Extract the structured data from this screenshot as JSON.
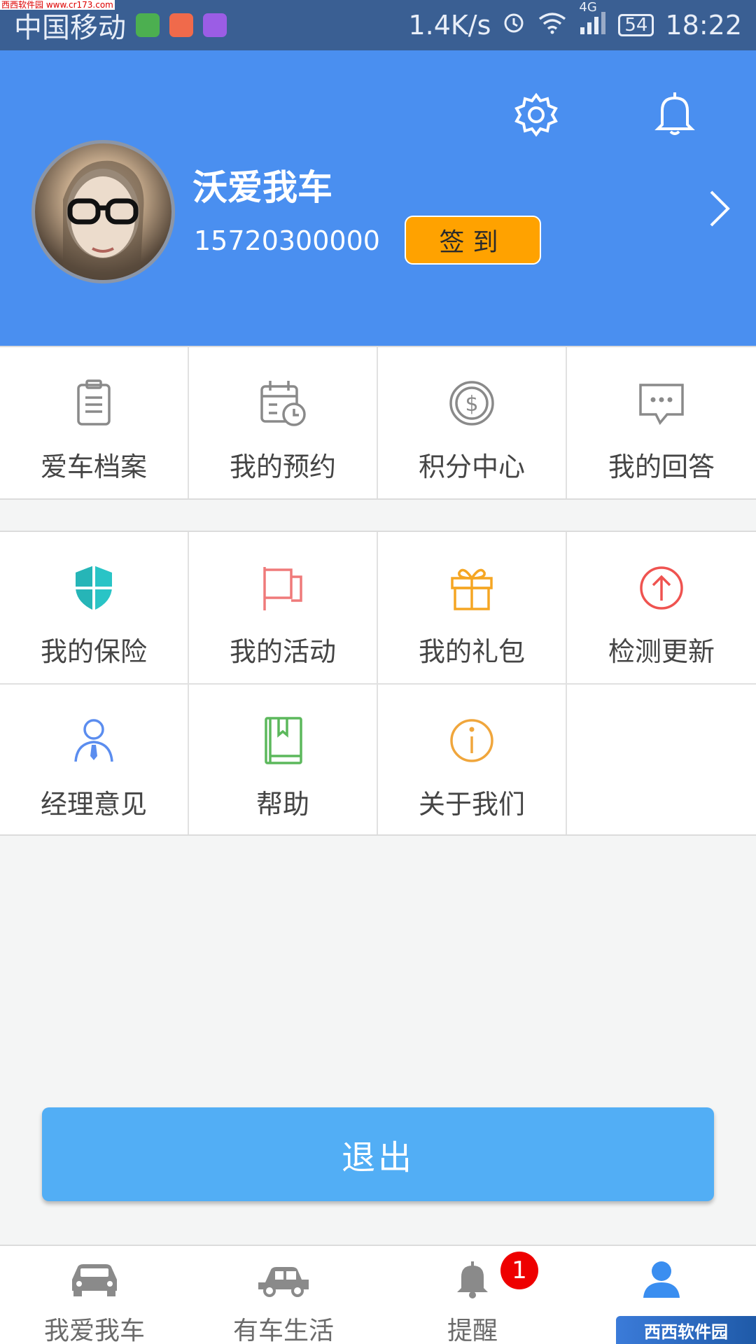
{
  "status_bar": {
    "carrier": "中国移动",
    "net_speed": "1.4K/s",
    "network": "4G",
    "battery": "54",
    "time": "18:22",
    "watermark": "西西软件园 www.cr173.com"
  },
  "header": {
    "user_name": "沃爱我车",
    "phone": "15720300000",
    "checkin_label": "签到"
  },
  "grid_top": [
    {
      "label": "爱车档案",
      "icon": "clipboard-icon",
      "color": "#8a8a8a"
    },
    {
      "label": "我的预约",
      "icon": "calendar-clock-icon",
      "color": "#8a8a8a"
    },
    {
      "label": "积分中心",
      "icon": "coin-dollar-icon",
      "color": "#8a8a8a"
    },
    {
      "label": "我的回答",
      "icon": "chat-bubble-icon",
      "color": "#8a8a8a"
    }
  ],
  "grid_bottom": [
    {
      "label": "我的保险",
      "icon": "shield-icon",
      "color": "#29c4c6"
    },
    {
      "label": "我的活动",
      "icon": "flag-icon",
      "color": "#ef7a7a"
    },
    {
      "label": "我的礼包",
      "icon": "gift-icon",
      "color": "#f5a623"
    },
    {
      "label": "检测更新",
      "icon": "arrow-up-circle-icon",
      "color": "#ef5350"
    },
    {
      "label": "经理意见",
      "icon": "manager-icon",
      "color": "#5b8def"
    },
    {
      "label": "帮助",
      "icon": "book-icon",
      "color": "#5cb85c"
    },
    {
      "label": "关于我们",
      "icon": "info-circle-icon",
      "color": "#f0a63c"
    }
  ],
  "logout_label": "退出",
  "bottom_nav": [
    {
      "label": "我爱我车",
      "icon": "car-icon",
      "active": false
    },
    {
      "label": "有车生活",
      "icon": "sedan-icon",
      "active": false
    },
    {
      "label": "提醒",
      "icon": "bell-icon",
      "active": false,
      "badge": "1"
    },
    {
      "label": "",
      "icon": "person-icon",
      "active": true
    }
  ],
  "bottom_watermark": "西西软件园",
  "colors": {
    "header_bg": "#4a8ff0",
    "checkin_bg": "#ffa200",
    "logout_bg": "#52aef5",
    "active_tab": "#3a8ef0"
  }
}
